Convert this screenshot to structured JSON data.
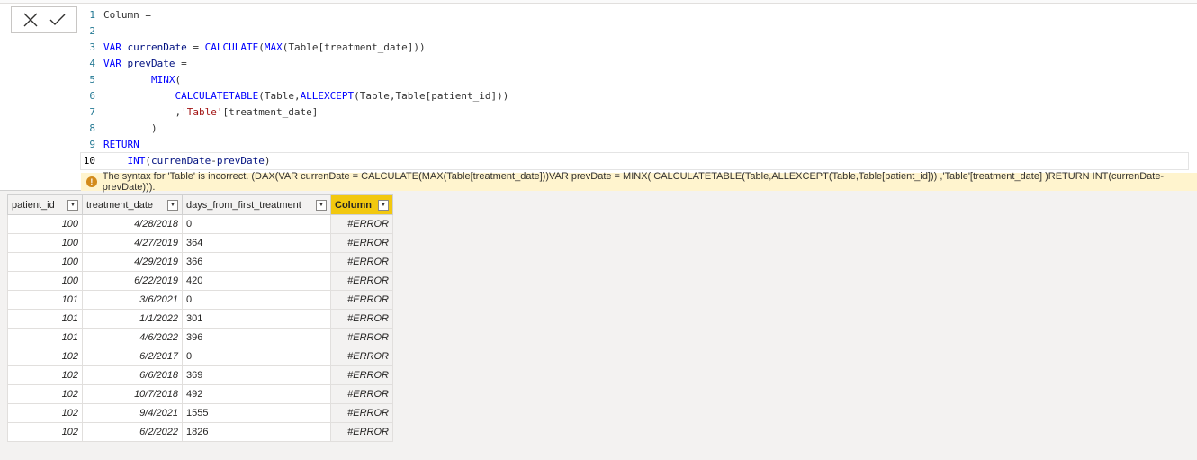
{
  "editor": {
    "lines": [
      {
        "n": "1",
        "parts": [
          [
            "txt",
            "Column ="
          ]
        ]
      },
      {
        "n": "2",
        "parts": []
      },
      {
        "n": "3",
        "parts": [
          [
            "kw",
            "VAR"
          ],
          [
            "txt",
            " "
          ],
          [
            "id",
            "currenDate"
          ],
          [
            "txt",
            " = "
          ],
          [
            "fn",
            "CALCULATE"
          ],
          [
            "txt",
            "("
          ],
          [
            "fn",
            "MAX"
          ],
          [
            "txt",
            "(Table[treatment_date]))"
          ]
        ]
      },
      {
        "n": "4",
        "parts": [
          [
            "kw",
            "VAR"
          ],
          [
            "txt",
            " "
          ],
          [
            "id",
            "prevDate"
          ],
          [
            "txt",
            " ="
          ]
        ]
      },
      {
        "n": "5",
        "parts": [
          [
            "txt",
            "        "
          ],
          [
            "fn",
            "MINX"
          ],
          [
            "txt",
            "("
          ]
        ]
      },
      {
        "n": "6",
        "parts": [
          [
            "txt",
            "            "
          ],
          [
            "fn",
            "CALCULATETABLE"
          ],
          [
            "txt",
            "(Table,"
          ],
          [
            "fn",
            "ALLEXCEPT"
          ],
          [
            "txt",
            "(Table,Table[patient_id]))"
          ]
        ]
      },
      {
        "n": "7",
        "parts": [
          [
            "txt",
            "            ,"
          ],
          [
            "str",
            "'Table'"
          ],
          [
            "txt",
            "[treatment_date]"
          ]
        ]
      },
      {
        "n": "8",
        "parts": [
          [
            "txt",
            "        )"
          ]
        ]
      },
      {
        "n": "9",
        "parts": [
          [
            "kw",
            "RETURN"
          ]
        ]
      },
      {
        "n": "10",
        "parts": [
          [
            "txt",
            "    "
          ],
          [
            "fn",
            "INT"
          ],
          [
            "txt",
            "("
          ],
          [
            "id",
            "currenDate"
          ],
          [
            "txt",
            "-"
          ],
          [
            "id",
            "prevDate"
          ],
          [
            "txt",
            ")"
          ]
        ]
      }
    ],
    "error_message": "The syntax for 'Table' is incorrect. (DAX(VAR currenDate = CALCULATE(MAX(Table[treatment_date]))VAR prevDate = MINX( CALCULATETABLE(Table,ALLEXCEPT(Table,Table[patient_id])) ,'Table'[treatment_date] )RETURN INT(currenDate-prevDate)))."
  },
  "table": {
    "columns": [
      "patient_id",
      "treatment_date",
      "days_from_first_treatment",
      "Column"
    ],
    "rows": [
      [
        "100",
        "4/28/2018",
        "0",
        "#ERROR"
      ],
      [
        "100",
        "4/27/2019",
        "364",
        "#ERROR"
      ],
      [
        "100",
        "4/29/2019",
        "366",
        "#ERROR"
      ],
      [
        "100",
        "6/22/2019",
        "420",
        "#ERROR"
      ],
      [
        "101",
        "3/6/2021",
        "0",
        "#ERROR"
      ],
      [
        "101",
        "1/1/2022",
        "301",
        "#ERROR"
      ],
      [
        "101",
        "4/6/2022",
        "396",
        "#ERROR"
      ],
      [
        "102",
        "6/2/2017",
        "0",
        "#ERROR"
      ],
      [
        "102",
        "6/6/2018",
        "369",
        "#ERROR"
      ],
      [
        "102",
        "10/7/2018",
        "492",
        "#ERROR"
      ],
      [
        "102",
        "9/4/2021",
        "1555",
        "#ERROR"
      ],
      [
        "102",
        "6/2/2022",
        "1826",
        "#ERROR"
      ]
    ]
  }
}
